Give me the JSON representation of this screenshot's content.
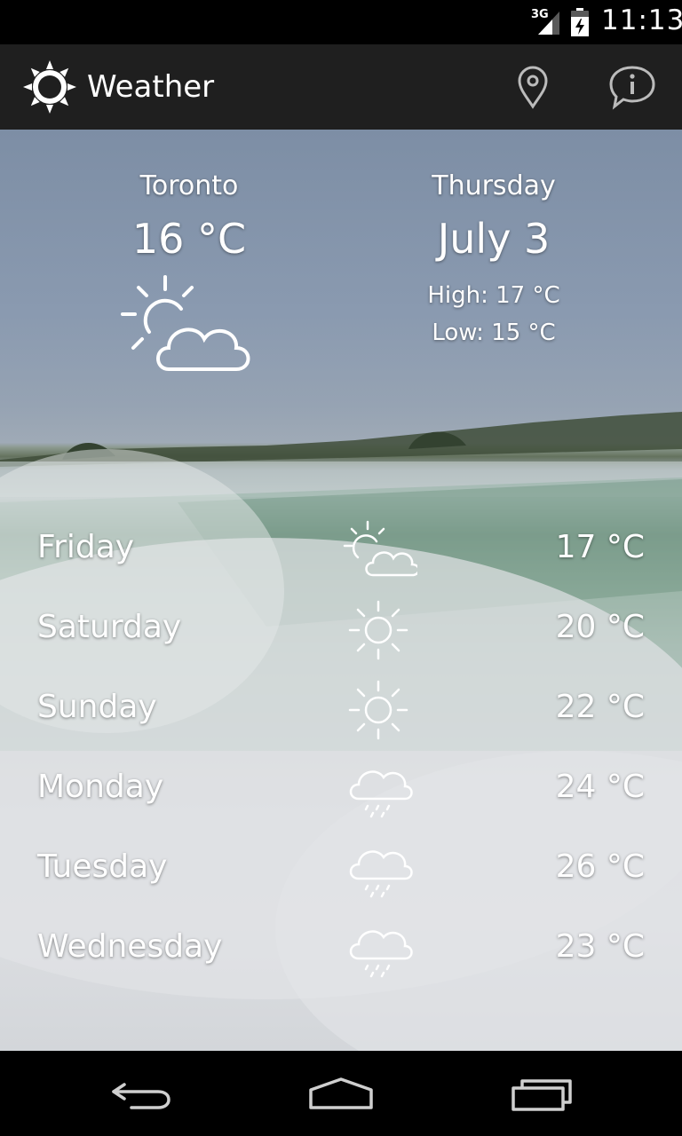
{
  "status_bar": {
    "network": "3G",
    "time": "11:13"
  },
  "action_bar": {
    "title": "Weather",
    "app_icon": "sun-icon",
    "actions": [
      "location-pin-icon",
      "info-icon"
    ]
  },
  "current": {
    "city": "Toronto",
    "temperature": "16 °C",
    "condition_icon": "partly-cloudy-icon",
    "day": "Thursday",
    "date": "July 3",
    "high": "High: 17 °C",
    "low": "Low: 15 °C"
  },
  "forecast": [
    {
      "day": "Friday",
      "icon": "partly-cloudy-icon",
      "temp": "17 °C"
    },
    {
      "day": "Saturday",
      "icon": "sun-icon",
      "temp": "20 °C"
    },
    {
      "day": "Sunday",
      "icon": "sun-icon",
      "temp": "22 °C"
    },
    {
      "day": "Monday",
      "icon": "rain-cloud-icon",
      "temp": "24 °C"
    },
    {
      "day": "Tuesday",
      "icon": "rain-cloud-icon",
      "temp": "26 °C"
    },
    {
      "day": "Wednesday",
      "icon": "rain-cloud-icon",
      "temp": "23 °C"
    }
  ],
  "nav_bar": {
    "buttons": [
      "back-icon",
      "home-icon",
      "recent-apps-icon"
    ]
  },
  "colors": {
    "action_bar_bg": "#1f1f1f",
    "status_bar_bg": "#000000",
    "text": "#ffffff"
  }
}
